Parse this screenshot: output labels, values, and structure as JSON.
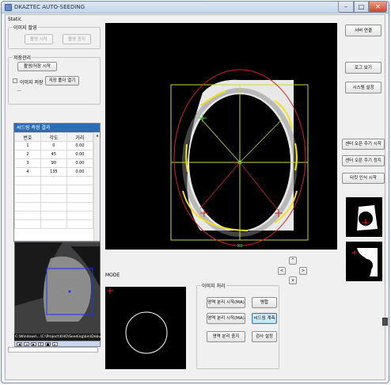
{
  "window": {
    "title": "DKAZTEC AUTO-SEEDING",
    "min_glyph": "–",
    "max_glyph": "□",
    "close_glyph": "✕"
  },
  "static_label": "Static",
  "capture_group": {
    "title": "이미지 촬영",
    "start_label": "촬영 시작",
    "stop_label": "촬영 중지"
  },
  "storage_group": {
    "title": "저장관리",
    "start_save_label": "촬영/저장 시작",
    "save_image_label": "이미지 저장",
    "save_image_checked": false,
    "open_folder_label": "저장 폴더 열기",
    "dash": "—"
  },
  "seeding_table": {
    "title": "씨드링 측정 결과",
    "columns": [
      "번호",
      "각도",
      "거리"
    ],
    "rows": [
      [
        "1",
        "0",
        "0.00"
      ],
      [
        "2",
        "45",
        "0.00"
      ],
      [
        "3",
        "90",
        "0.00"
      ],
      [
        "4",
        "135",
        "0.00"
      ]
    ],
    "scroll_glyph": "▲"
  },
  "video": {
    "status_text": "C:\\Windows\\...\\C:\\Project\\KHO\\Seeding\\bin\\Debug\\MTC\\씨드링판정 영상"
  },
  "right_buttons": {
    "server": "서버 연결",
    "log": "로그 보기",
    "system": "시스템 설정",
    "auto_start": "센터 오픈 주기 시작",
    "auto_stop": "센터 오픈 주기 정지",
    "teach": "타킷 인식 시작"
  },
  "nav": {
    "up": "^",
    "left": "<",
    "right": ">",
    "down": "v"
  },
  "mode_label": "MODE",
  "processing": {
    "title": "이미지 처리",
    "sep_start_1": "영역 분리 시작(MA)",
    "merge": "병합",
    "sep_start_2": "영역 분리 시작(MA)",
    "seeding_measure": "씨드링 계측",
    "sep_stop": "영역 분리 중지",
    "inspect_settings": "검사 설정"
  },
  "camera": {
    "axis_label": "X0"
  },
  "colors": {
    "titlebar": "#c5d6ec",
    "table_header": "#2d6db5",
    "crosshair": "#c8d83a",
    "ellipse": "#d42020",
    "contour": "#f0e020"
  }
}
